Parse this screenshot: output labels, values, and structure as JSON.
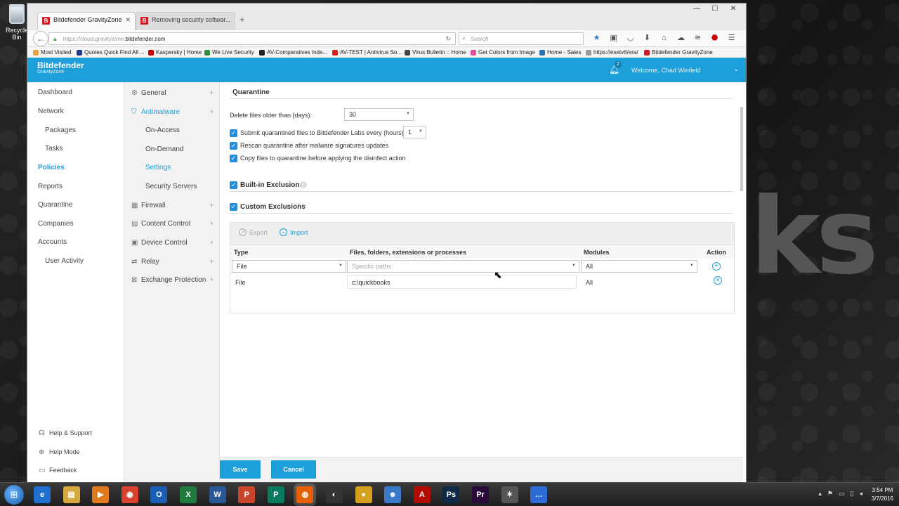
{
  "desktop": {
    "recycle_label": "Recycle Bin",
    "background_text": "ks"
  },
  "browser": {
    "tabs": [
      {
        "label": "Bitdefender GravityZone",
        "active": true,
        "favicon": "B"
      },
      {
        "label": "Removing security softwar...",
        "active": false,
        "favicon": "B"
      }
    ],
    "new_tab": "+",
    "window_controls": [
      "—",
      "☐",
      "✕"
    ],
    "url_prefix": "https://cloud.gravityzone.",
    "url_host": "bitdefender.com",
    "search_placeholder": "Search",
    "bookmarks": [
      {
        "label": "Most Visited",
        "color": "#e8a33c"
      },
      {
        "label": "Quotes Quick Find All ...",
        "color": "#1a3d8f"
      },
      {
        "label": "Kaspersky | Home",
        "color": "#c40000"
      },
      {
        "label": "We Live Security",
        "color": "#2f8f3e"
      },
      {
        "label": "AV-Comparatives Inde...",
        "color": "#202020"
      },
      {
        "label": "AV-TEST | Antivirus So...",
        "color": "#d82020"
      },
      {
        "label": "Virus Bulletin :: Home",
        "color": "#444444"
      },
      {
        "label": "Get Colors from Image",
        "color": "#e04fa0"
      },
      {
        "label": "Home - Sales",
        "color": "#2c6fb4"
      },
      {
        "label": "https://esetv6/era/",
        "color": "#999999"
      },
      {
        "label": "Bitdefender GravityZone",
        "color": "#d11a2a"
      }
    ]
  },
  "app": {
    "brand_line1": "Bitdefender",
    "brand_line2": "GravityZone",
    "notification_count": "2",
    "welcome": "Welcome, Chad Winfield",
    "accent_color": "#1d9fd9",
    "nav_left": [
      {
        "label": "Dashboard",
        "sub": false,
        "active": false
      },
      {
        "label": "Network",
        "sub": false,
        "active": false
      },
      {
        "label": "Packages",
        "sub": true,
        "active": false
      },
      {
        "label": "Tasks",
        "sub": true,
        "active": false
      },
      {
        "label": "Policies",
        "sub": false,
        "active": true
      },
      {
        "label": "Reports",
        "sub": false,
        "active": false
      },
      {
        "label": "Quarantine",
        "sub": false,
        "active": false
      },
      {
        "label": "Companies",
        "sub": false,
        "active": false
      },
      {
        "label": "Accounts",
        "sub": false,
        "active": false
      },
      {
        "label": "User Activity",
        "sub": true,
        "active": false
      }
    ],
    "nav_footer": [
      {
        "label": "Help & Support",
        "icon": "headset-icon"
      },
      {
        "label": "Help Mode",
        "icon": "lifebuoy-icon"
      },
      {
        "label": "Feedback",
        "icon": "feedback-icon"
      }
    ],
    "nav_mid": [
      {
        "label": "General",
        "icon": "gear-icon",
        "active": false
      },
      {
        "label": "Antimalware",
        "icon": "shield-icon",
        "active": true
      },
      {
        "label": "Firewall",
        "icon": "brick-wall-icon",
        "active": false
      },
      {
        "label": "Content Control",
        "icon": "content-control-icon",
        "active": false
      },
      {
        "label": "Device Control",
        "icon": "device-icon",
        "active": false
      },
      {
        "label": "Relay",
        "icon": "relay-icon",
        "active": false
      },
      {
        "label": "Exchange Protection",
        "icon": "exchange-icon",
        "active": false
      }
    ],
    "nav_mid_sub": [
      {
        "label": "On-Access",
        "active": false
      },
      {
        "label": "On-Demand",
        "active": false
      },
      {
        "label": "Settings",
        "active": true
      },
      {
        "label": "Security Servers",
        "active": false
      }
    ],
    "quarantine": {
      "title": "Quarantine",
      "delete_label": "Delete files older than (days):",
      "delete_value": "30",
      "submit_label": "Submit quarantined files to Bitdefender Labs every (hours)",
      "submit_value": "1",
      "submit_checked": true,
      "rescan_label": "Rescan quarantine after malware signatures updates",
      "rescan_checked": true,
      "copy_label": "Copy files to quarantine before applying the disinfect action",
      "copy_checked": true
    },
    "builtin_exclusions": {
      "label": "Built-in Exclusions",
      "checked": true
    },
    "custom_exclusions": {
      "label": "Custom Exclusions",
      "checked": true,
      "export_label": "Export",
      "import_label": "Import",
      "columns": [
        "Type",
        "Files, folders, extensions or processes",
        "Modules",
        "Action"
      ],
      "filter": {
        "type": "File",
        "paths_placeholder": "Specific paths",
        "modules": "All"
      },
      "rows": [
        {
          "type": "File",
          "path": "c:\\quickbooks",
          "modules": "All"
        }
      ]
    },
    "save_label": "Save",
    "cancel_label": "Cancel"
  },
  "taskbar": {
    "apps": [
      {
        "name": "internet-explorer",
        "glyph": "e",
        "color": "#1e6fd0"
      },
      {
        "name": "file-explorer",
        "glyph": "▤",
        "color": "#d6a840"
      },
      {
        "name": "media-player",
        "glyph": "▶",
        "color": "#e07a1e"
      },
      {
        "name": "chrome",
        "glyph": "◉",
        "color": "#d8432f"
      },
      {
        "name": "outlook",
        "glyph": "O",
        "color": "#1a5fb4"
      },
      {
        "name": "excel",
        "glyph": "X",
        "color": "#1f7a3e"
      },
      {
        "name": "word",
        "glyph": "W",
        "color": "#2b5797"
      },
      {
        "name": "powerpoint",
        "glyph": "P",
        "color": "#c8452c"
      },
      {
        "name": "publisher",
        "glyph": "P",
        "color": "#087a60"
      },
      {
        "name": "firefox",
        "glyph": "◍",
        "color": "#e66000"
      },
      {
        "name": "obs",
        "glyph": "◐",
        "color": "#333333"
      },
      {
        "name": "app-12",
        "glyph": "●",
        "color": "#d4a020"
      },
      {
        "name": "app-13",
        "glyph": "☻",
        "color": "#3a79c5"
      },
      {
        "name": "acrobat",
        "glyph": "A",
        "color": "#b30b00"
      },
      {
        "name": "photoshop",
        "glyph": "Ps",
        "color": "#0e2a47"
      },
      {
        "name": "premiere",
        "glyph": "Pr",
        "color": "#2a0a3a"
      },
      {
        "name": "app-17",
        "glyph": "✶",
        "color": "#555555"
      },
      {
        "name": "chat",
        "glyph": "…",
        "color": "#2d6bd6"
      }
    ],
    "time": "3:54 PM",
    "date": "3/7/2016"
  }
}
